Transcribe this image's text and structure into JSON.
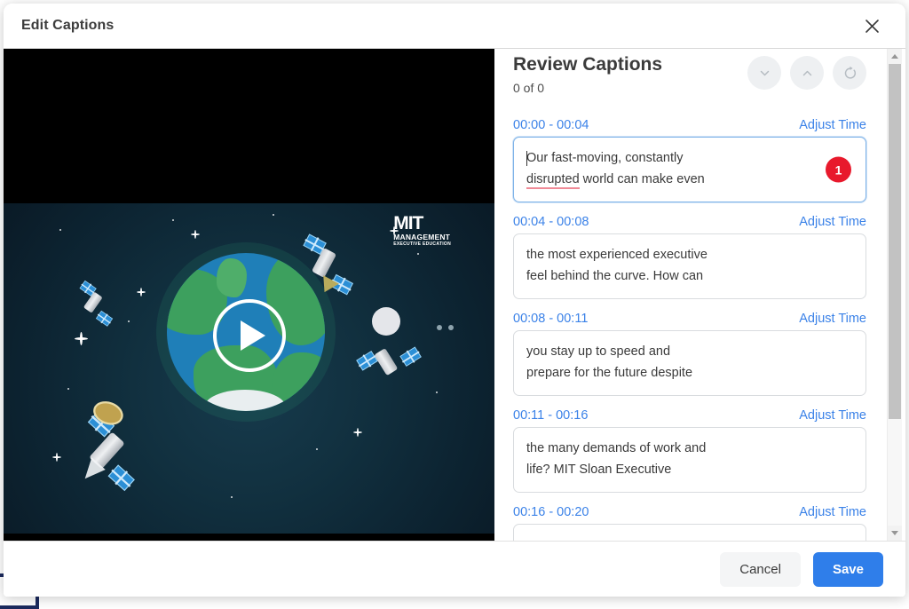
{
  "modal": {
    "title": "Edit Captions",
    "close_icon": "close-icon"
  },
  "video": {
    "play_icon": "play-icon",
    "logo": {
      "line1": "MIT",
      "line2": "MANAGEMENT",
      "line3": "EXECUTIVE EDUCATION"
    }
  },
  "captions_panel": {
    "heading": "Review Captions",
    "counter": "0 of 0",
    "actions": [
      {
        "name": "next-caption-button",
        "icon": "chevron-down-icon"
      },
      {
        "name": "previous-caption-button",
        "icon": "chevron-up-icon"
      },
      {
        "name": "reset-captions-button",
        "icon": "refresh-icon"
      }
    ],
    "adjust_time_label": "Adjust Time",
    "items": [
      {
        "time": "00:00 - 00:04",
        "text_before": "Our fast-moving, constantly\n",
        "misspelled": "disrupted",
        "text_after": " world can make even",
        "active": true,
        "badge": "1"
      },
      {
        "time": "00:04 - 00:08",
        "text": "the most experienced executive\nfeel behind the curve. How can",
        "active": false,
        "badge": null
      },
      {
        "time": "00:08 - 00:11",
        "text": "you stay up to speed and\nprepare for the future despite",
        "active": false,
        "badge": null
      },
      {
        "time": "00:11 - 00:16",
        "text": "the many demands of work and\nlife? MIT Sloan Executive",
        "active": false,
        "badge": null
      },
      {
        "time": "00:16 - 00:20",
        "text": "",
        "active": false,
        "badge": null
      }
    ]
  },
  "footer": {
    "cancel_label": "Cancel",
    "save_label": "Save"
  },
  "colors": {
    "accent_blue": "#3b82e8",
    "save_blue": "#2f7eea",
    "badge_red": "#e8192c",
    "spellcheck_underline": "#f08a96"
  }
}
